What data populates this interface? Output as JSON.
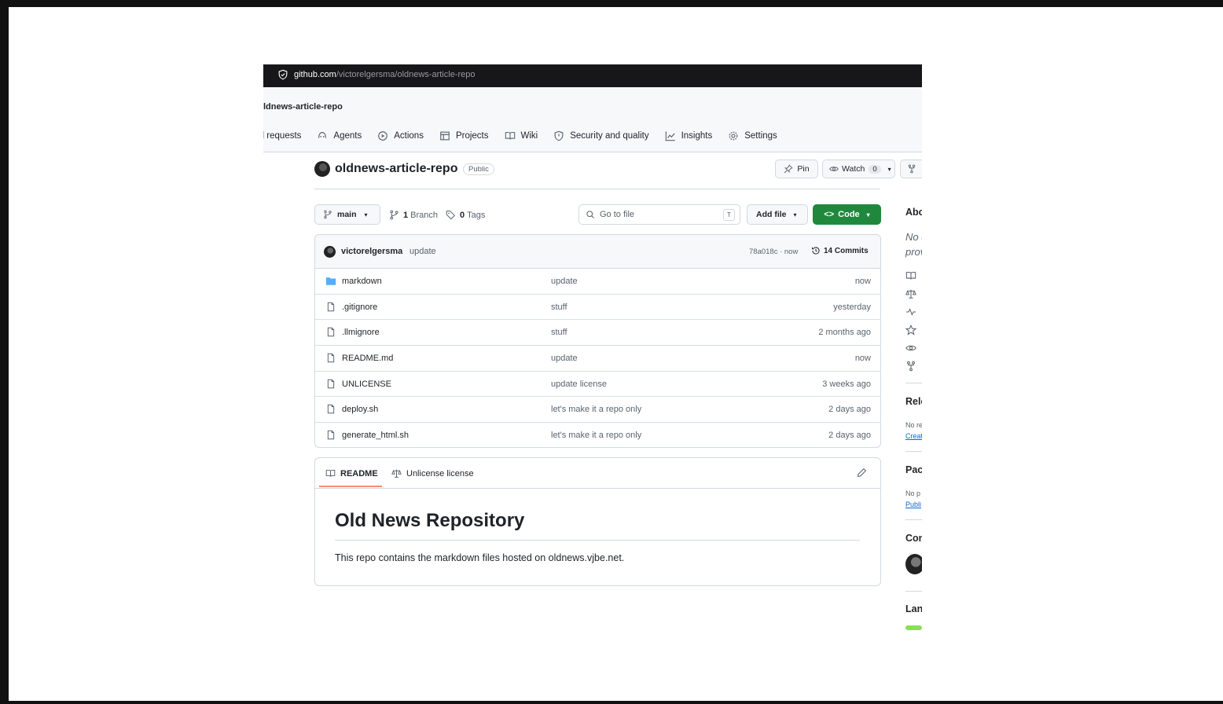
{
  "browser": {
    "url_host": "github.com",
    "url_path": "/victorelgersma/oldnews-article-repo"
  },
  "header": {
    "breadcrumb": "ldnews-article-repo",
    "nav": [
      {
        "label": "ll requests",
        "icon": "pull-request-icon"
      },
      {
        "label": "Agents",
        "icon": "agents-icon"
      },
      {
        "label": "Actions",
        "icon": "play-icon"
      },
      {
        "label": "Projects",
        "icon": "table-icon"
      },
      {
        "label": "Wiki",
        "icon": "book-icon"
      },
      {
        "label": "Security and quality",
        "icon": "shield-icon"
      },
      {
        "label": "Insights",
        "icon": "graph-icon"
      },
      {
        "label": "Settings",
        "icon": "gear-icon"
      }
    ]
  },
  "repo": {
    "name": "oldnews-article-repo",
    "visibility": "Public",
    "pin_label": "Pin",
    "watch_label": "Watch",
    "watch_count": "0"
  },
  "toolbar": {
    "branch": "main",
    "branch_count": "1",
    "branch_label": "Branch",
    "tag_count": "0",
    "tag_label": "Tags",
    "search_placeholder": "Go to file",
    "search_key": "T",
    "add_file": "Add file",
    "code": "Code"
  },
  "commit": {
    "author": "victorelgersma",
    "message": "update",
    "sha_time": "78a018c · now",
    "commits": "14 Commits"
  },
  "files": [
    {
      "name": "markdown",
      "type": "folder",
      "message": "update",
      "date": "now"
    },
    {
      "name": ".gitignore",
      "type": "file",
      "message": "stuff",
      "date": "yesterday"
    },
    {
      "name": ".llmignore",
      "type": "file",
      "message": "stuff",
      "date": "2 months ago"
    },
    {
      "name": "README.md",
      "type": "file",
      "message": "update",
      "date": "now"
    },
    {
      "name": "UNLICENSE",
      "type": "file",
      "message": "update license",
      "date": "3 weeks ago"
    },
    {
      "name": "deploy.sh",
      "type": "file",
      "message": "let's make it a repo only",
      "date": "2 days ago"
    },
    {
      "name": "generate_html.sh",
      "type": "file",
      "message": "let's make it a repo only",
      "date": "2 days ago"
    }
  ],
  "readme": {
    "tab_readme": "README",
    "tab_license": "Unlicense license",
    "title": "Old News Repository",
    "description": "This repo contains the markdown files hosted on oldnews.vjbe.net."
  },
  "sidebar": {
    "about": "Abo",
    "about_text_1": "No d",
    "about_text_2": "prov",
    "releases": "Rele",
    "releases_text": "No re",
    "releases_link": "Creat",
    "packages": "Pac",
    "packages_text": "No p",
    "packages_link": "Publi",
    "contributors": "Con",
    "languages": "Lan",
    "language_color": "#89e051"
  },
  "colors": {
    "accent_green": "#1f883d",
    "link": "#0969da",
    "folder": "#54aeff",
    "tab_underline": "#fd8c73"
  }
}
